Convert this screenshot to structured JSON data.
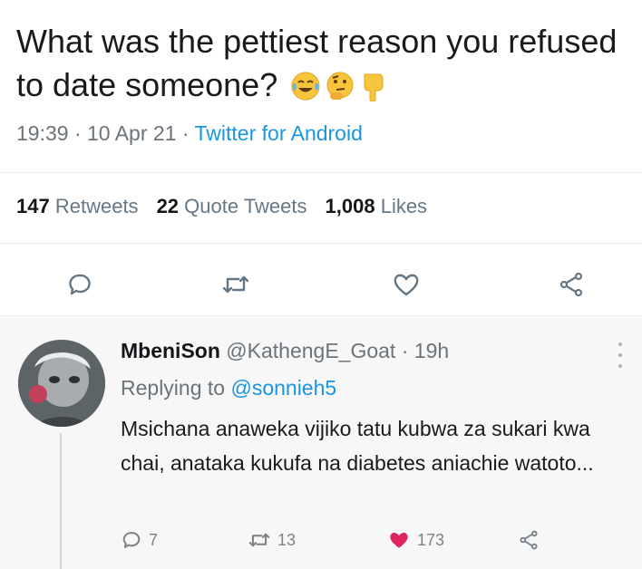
{
  "tweet": {
    "text": "What was the pettiest reason you refused to date someone?",
    "emojis": [
      "tears-of-joy-emoji",
      "thinking-face-emoji",
      "backhand-index-pointing-down-emoji"
    ],
    "time": "19:39",
    "date": "10 Apr 21",
    "source": "Twitter for Android",
    "separator": " · "
  },
  "stats": {
    "retweets_count": "147",
    "retweets_label": "Retweets",
    "quotes_count": "22",
    "quotes_label": "Quote Tweets",
    "likes_count": "1,008",
    "likes_label": "Likes"
  },
  "actions": [
    "reply-icon",
    "retweet-icon",
    "like-icon",
    "share-icon"
  ],
  "reply": {
    "name": "MbeniSon",
    "handle": "@KathengE_Goat",
    "separator": " · ",
    "time": "19h",
    "replying_prefix": "Replying to ",
    "replying_handle": "@sonnieh5",
    "text": "Msichana anaweka vijiko tatu kubwa za sukari kwa chai, anataka kukufa na diabetes aniachie watoto...",
    "reply_count": "7",
    "retweet_count": "13",
    "like_count": "173",
    "like_color": "#e0245e"
  },
  "colors": {
    "link": "#1b95e0",
    "muted": "#6b737b",
    "like": "#e0245e"
  }
}
